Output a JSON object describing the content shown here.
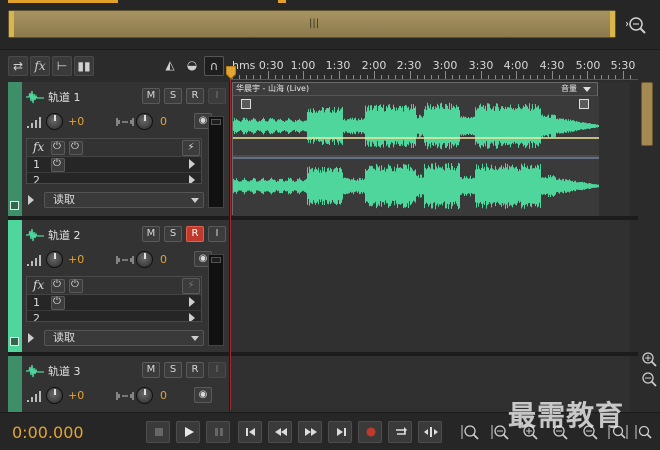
{
  "ruler": {
    "labels": [
      "hms 0:30",
      "1:00",
      "1:30",
      "2:00",
      "2:30",
      "3:00",
      "3:30",
      "4:00",
      "4:30",
      "5:00",
      "5:30"
    ]
  },
  "tracks": [
    {
      "name": "轨道 1",
      "volume": "+0",
      "pan": "0",
      "fx_label": "fx",
      "slot1": "1",
      "slot2": "2",
      "read_mode": "读取",
      "mute": "M",
      "solo": "S",
      "record": "R",
      "input": "I"
    },
    {
      "name": "轨道 2",
      "volume": "+0",
      "pan": "0",
      "fx_label": "fx",
      "slot1": "1",
      "slot2": "2",
      "read_mode": "读取",
      "mute": "M",
      "solo": "S",
      "record": "R",
      "input": "I"
    },
    {
      "name": "轨道 3",
      "volume": "+0",
      "pan": "0",
      "mute": "M",
      "solo": "S",
      "record": "R",
      "input": "I"
    }
  ],
  "clip": {
    "name": "华晨宇 - 山海 (Live)",
    "volume_label": "音量"
  },
  "transport": {
    "time": "0:00.000"
  },
  "watermark": "最需教育",
  "colors": {
    "waveform": "#4fd69c",
    "accent": "#e3a530",
    "record_active": "#c0392b"
  }
}
